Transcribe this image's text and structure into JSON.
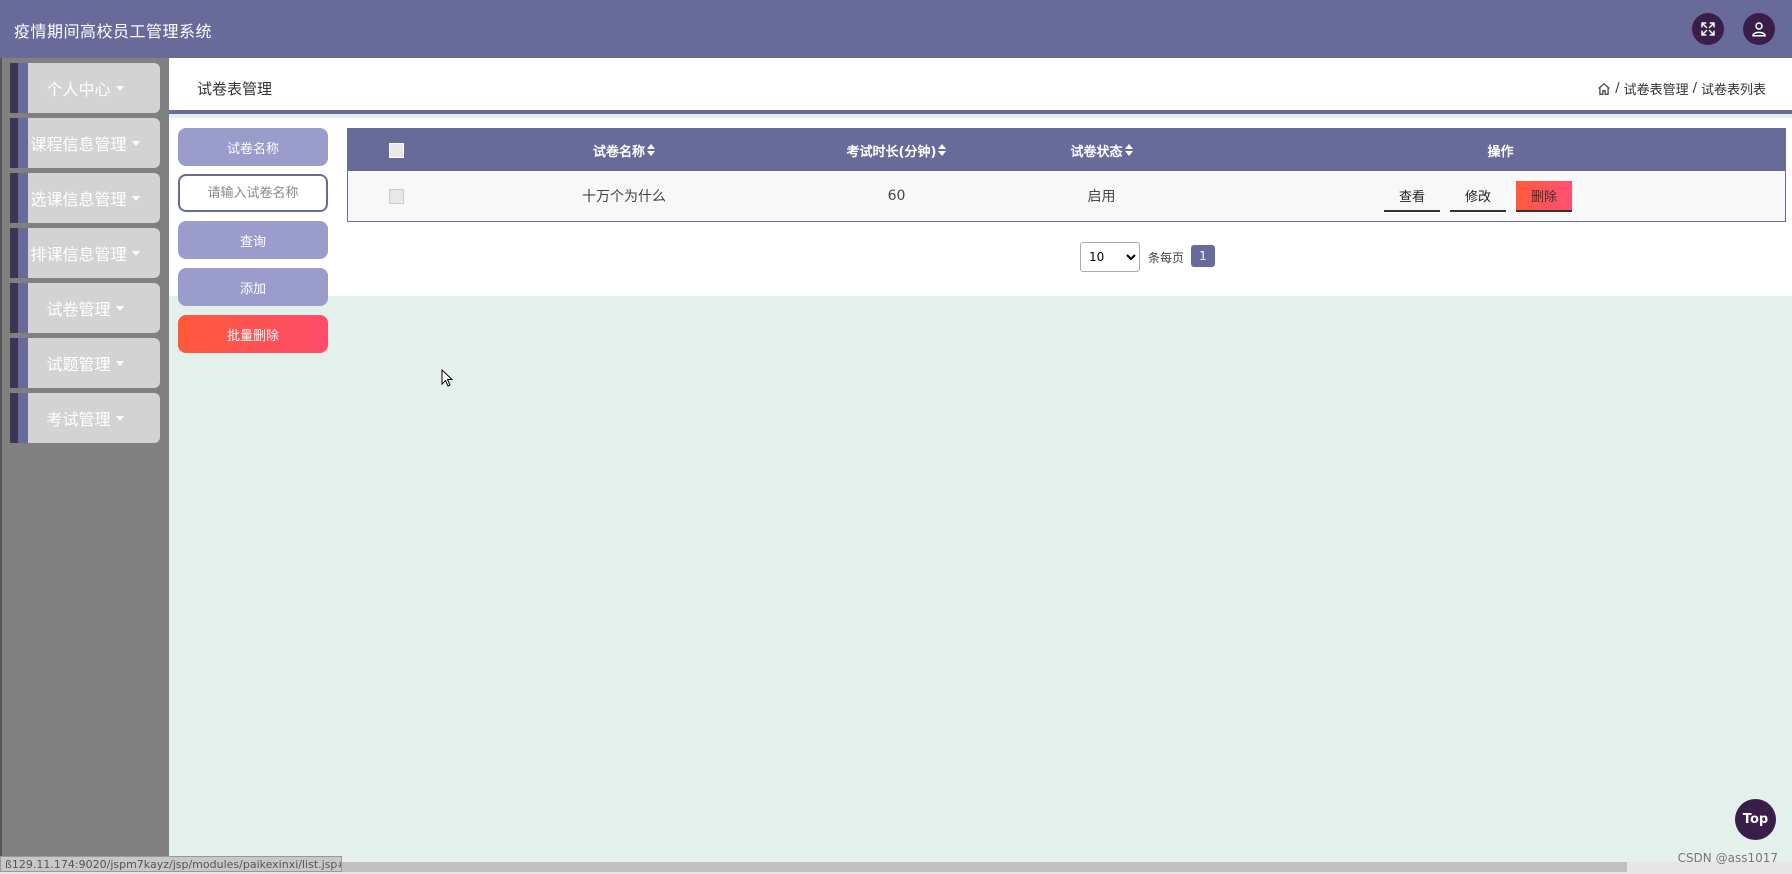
{
  "header": {
    "app_title": "疫情期间高校员工管理系统",
    "fullscreen_icon": "fullscreen-icon",
    "user_icon": "user-icon"
  },
  "sidebar": {
    "items": [
      {
        "label": "个人中心"
      },
      {
        "label": "课程信息管理"
      },
      {
        "label": "选课信息管理"
      },
      {
        "label": "排课信息管理"
      },
      {
        "label": "试卷管理"
      },
      {
        "label": "试题管理"
      },
      {
        "label": "考试管理"
      }
    ]
  },
  "page": {
    "title": "试卷表管理",
    "breadcrumb": [
      "试卷表管理",
      "试卷表列表"
    ],
    "breadcrumb_sep": "/"
  },
  "filters": {
    "name_label": "试卷名称",
    "name_placeholder": "请输入试卷名称",
    "name_value": "",
    "query_label": "查询",
    "add_label": "添加",
    "batch_delete_label": "批量删除"
  },
  "table": {
    "columns": [
      "试卷名称",
      "考试时长(分钟)",
      "试卷状态",
      "操作"
    ],
    "rows": [
      {
        "name": "十万个为什么",
        "duration": "60",
        "status": "启用"
      }
    ],
    "actions": {
      "view": "查看",
      "edit": "修改",
      "delete": "删除"
    }
  },
  "pagination": {
    "page_size": "10",
    "page_size_options": [
      "10"
    ],
    "per_page_label": "条每页",
    "current_page": "1"
  },
  "misc": {
    "top_label": "Top",
    "status_url": "ß129.11.174:9020/jspm7kayz/jsp/modules/paikexinxi/list.jsp#",
    "watermark": "CSDN @ass1017"
  },
  "colors": {
    "primary": "#686a9a",
    "accent_dark": "#3a1e4a",
    "danger": "#ff5a3a",
    "content_bg": "#e4f0ec"
  }
}
